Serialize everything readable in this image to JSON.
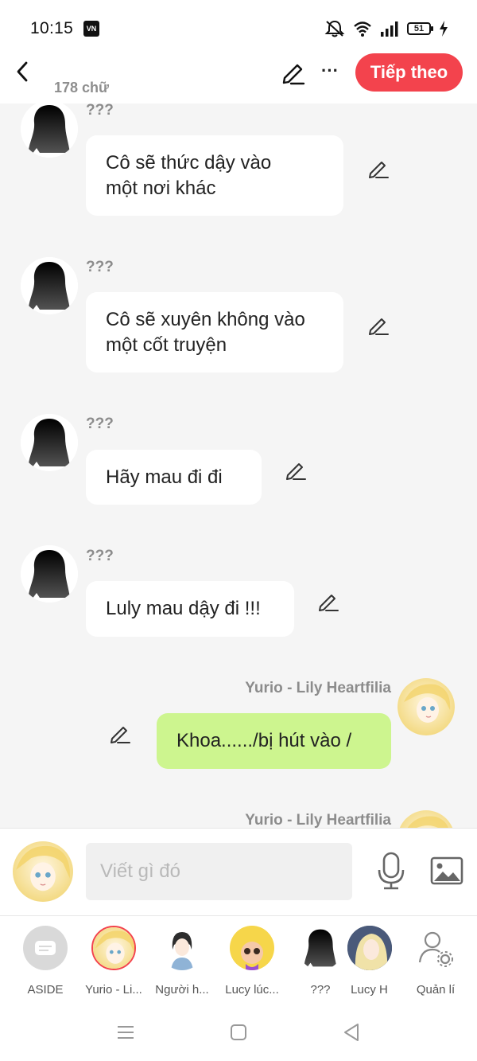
{
  "status": {
    "time": "10:15",
    "badge": "VN",
    "battery": "51"
  },
  "header": {
    "word_count": "178 chữ",
    "next_label": "Tiếp theo",
    "more_label": "···"
  },
  "messages": [
    {
      "sender": "???",
      "text_line1": "Cô sẽ thức dậy vào",
      "text_line2": "một nơi khác"
    },
    {
      "sender": "???",
      "text_line1": "Cô sẽ xuyên không vào",
      "text_line2": "một cốt truyện"
    },
    {
      "sender": "???",
      "text": "Hãy mau đi đi"
    },
    {
      "sender": "???",
      "text": "Luly mau dậy đi !!!"
    },
    {
      "sender": "Yurio - Lily Heartfilia",
      "text": "Khoa....../bị hút vào /"
    },
    {
      "sender": "Yurio - Lily Heartfilia"
    }
  ],
  "input": {
    "placeholder": "Viết gì đó"
  },
  "characters": [
    {
      "label": "ASIDE",
      "icon": "aside-icon"
    },
    {
      "label": "Yurio - Li..."
    },
    {
      "label": "Người h..."
    },
    {
      "label": "Lucy lúc..."
    },
    {
      "label": "???"
    },
    {
      "label": "Lucy H"
    },
    {
      "label": "Quản lí",
      "icon": "manage-user-icon"
    }
  ],
  "colors": {
    "accent": "#f3434d",
    "my_bubble": "#cdf58f",
    "background": "#f5f5f5"
  }
}
